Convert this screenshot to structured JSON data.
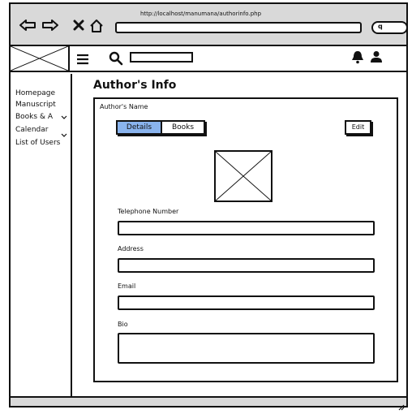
{
  "browser": {
    "url": "http://localhost/manumana/authorinfo.php",
    "search_placeholder": "q",
    "icons": [
      "back-arrow-icon",
      "forward-arrow-icon",
      "close-icon",
      "home-icon"
    ]
  },
  "header": {
    "icons": [
      "logo-placeholder-icon",
      "hamburger-icon",
      "search-icon",
      "bell-icon",
      "user-icon"
    ]
  },
  "sidebar": {
    "items": [
      {
        "label": "Homepage"
      },
      {
        "label": "Manuscript"
      },
      {
        "label": "Books & A"
      },
      {
        "label": "Calendar"
      },
      {
        "label": "List of Users"
      }
    ]
  },
  "main": {
    "title": "Author's Info",
    "author_name": "Author's Name",
    "tabs": [
      {
        "label": "Details",
        "active": true
      },
      {
        "label": "Books",
        "active": false
      }
    ],
    "edit_label": "Edit",
    "fields": {
      "telephone": "Telephone Number",
      "address": "Address",
      "email": "Email",
      "bio": "Bio"
    }
  },
  "colors": {
    "active_tab": "#8ab4ee",
    "chrome": "#d9d9d9",
    "stroke": "#111111"
  }
}
